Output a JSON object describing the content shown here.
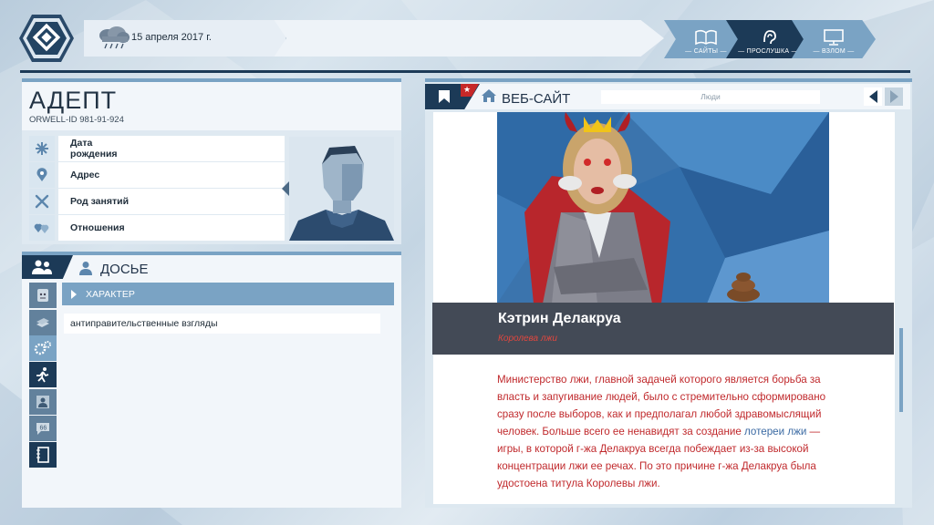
{
  "header": {
    "date": "15 апреля 2017 г.",
    "weather_icon": "cloud-rain-icon",
    "nav": [
      {
        "label": "— САЙТЫ —",
        "icon": "book-icon",
        "active": false
      },
      {
        "label": "— ПРОСЛУШКА —",
        "icon": "ear-icon",
        "active": true
      },
      {
        "label": "— ВЗЛОМ —",
        "icon": "monitor-icon",
        "active": false
      }
    ]
  },
  "profile": {
    "name": "АДЕПТ",
    "orwell_id": "ORWELL-ID  981-91-924",
    "fields": [
      {
        "label": "Дата рождения",
        "icon": "asterisk-icon"
      },
      {
        "label": "Адрес",
        "icon": "location-pin-icon"
      },
      {
        "label": "Род занятий",
        "icon": "tools-icon"
      },
      {
        "label": "Отношения",
        "icon": "hearts-icon"
      }
    ]
  },
  "dossier": {
    "title": "ДОСЬЕ",
    "category": "ХАРАКТЕР",
    "entry": "антиправительственные взгляды"
  },
  "website": {
    "title": "ВЕБ-САЙТ",
    "search_placeholder": "Люди",
    "person_name": "Кэтрин Делакруа",
    "person_title": "Королева лжи",
    "article_part1": "Министерство лжи, главной задачей которого является борьба за власть и запугивание людей, было с стремительно сформировано сразу после выборов, как и предполагал любой здравомыслящий человек. Больше всего ее ненавидят за создание ",
    "article_link": "лотереи лжи",
    "article_part2": " — игры, в которой г-жа Делакруа всегда побеждает из-за высокой концентрации лжи ее речах. По это причине г-жа Делакруа была удостоена титула Королевы лжи."
  },
  "colors": {
    "dark_navy": "#1c3a57",
    "accent_blue": "#7aa3c4",
    "article_red": "#c0292c",
    "link_blue": "#3b6aa3"
  }
}
